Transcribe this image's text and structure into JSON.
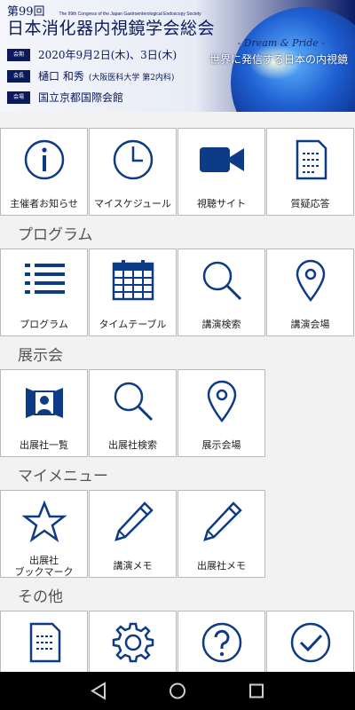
{
  "banner": {
    "congress_num": "第99回",
    "congress_en": "The 99th Congress of the Japan Gastroenterological Endoscopy Society",
    "title": "日本消化器内視鏡学会総会",
    "date_tag": "会期",
    "date": "2020年9月2日(木)、3日(木)",
    "chair_tag": "会長",
    "chair_name": "樋口 和秀",
    "chair_affiliation": "(大阪医科大学 第2内科)",
    "venue_tag": "会場",
    "venue": "国立京都国際会館",
    "slogan": "- Dream & Pride -",
    "tagline": "世界に発信する日本の内視鏡"
  },
  "top_tiles": [
    {
      "label": "主催者お知らせ",
      "icon": "info-icon"
    },
    {
      "label": "マイスケジュール",
      "icon": "clock-icon"
    },
    {
      "label": "視聴サイト",
      "icon": "video-camera-icon"
    },
    {
      "label": "質疑応答",
      "icon": "document-list-icon"
    }
  ],
  "sections": [
    {
      "title": "プログラム",
      "tiles": [
        {
          "label": "プログラム",
          "icon": "list-icon"
        },
        {
          "label": "タイムテーブル",
          "icon": "calendar-icon"
        },
        {
          "label": "講演検索",
          "icon": "search-icon"
        },
        {
          "label": "講演会場",
          "icon": "map-pin-icon"
        }
      ]
    },
    {
      "title": "展示会",
      "tiles": [
        {
          "label": "出展社一覧",
          "icon": "exhibitor-booth-icon"
        },
        {
          "label": "出展社検索",
          "icon": "search-icon"
        },
        {
          "label": "展示会場",
          "icon": "map-pin-icon"
        }
      ]
    },
    {
      "title": "マイメニュー",
      "tiles": [
        {
          "label": "出展社\nブックマーク",
          "label_line1": "出展社",
          "label_line2": "ブックマーク",
          "icon": "star-icon"
        },
        {
          "label": "講演メモ",
          "icon": "pencil-icon"
        },
        {
          "label": "出展社メモ",
          "icon": "pencil-icon"
        }
      ]
    },
    {
      "title": "その他",
      "tiles": [
        {
          "label": "",
          "icon": "document-icon"
        },
        {
          "label": "",
          "icon": "gear-icon"
        },
        {
          "label": "",
          "icon": "help-icon"
        },
        {
          "label": "",
          "icon": "check-circle-icon"
        }
      ]
    }
  ],
  "navbar": {
    "back": "back-icon",
    "home": "home-icon",
    "recents": "recents-icon"
  },
  "colors": {
    "icon": "#0d3b86",
    "background": "#f2f2f2",
    "tile": "#ffffff",
    "border": "#b9b9b9",
    "banner_navy": "#0a1a5a"
  }
}
